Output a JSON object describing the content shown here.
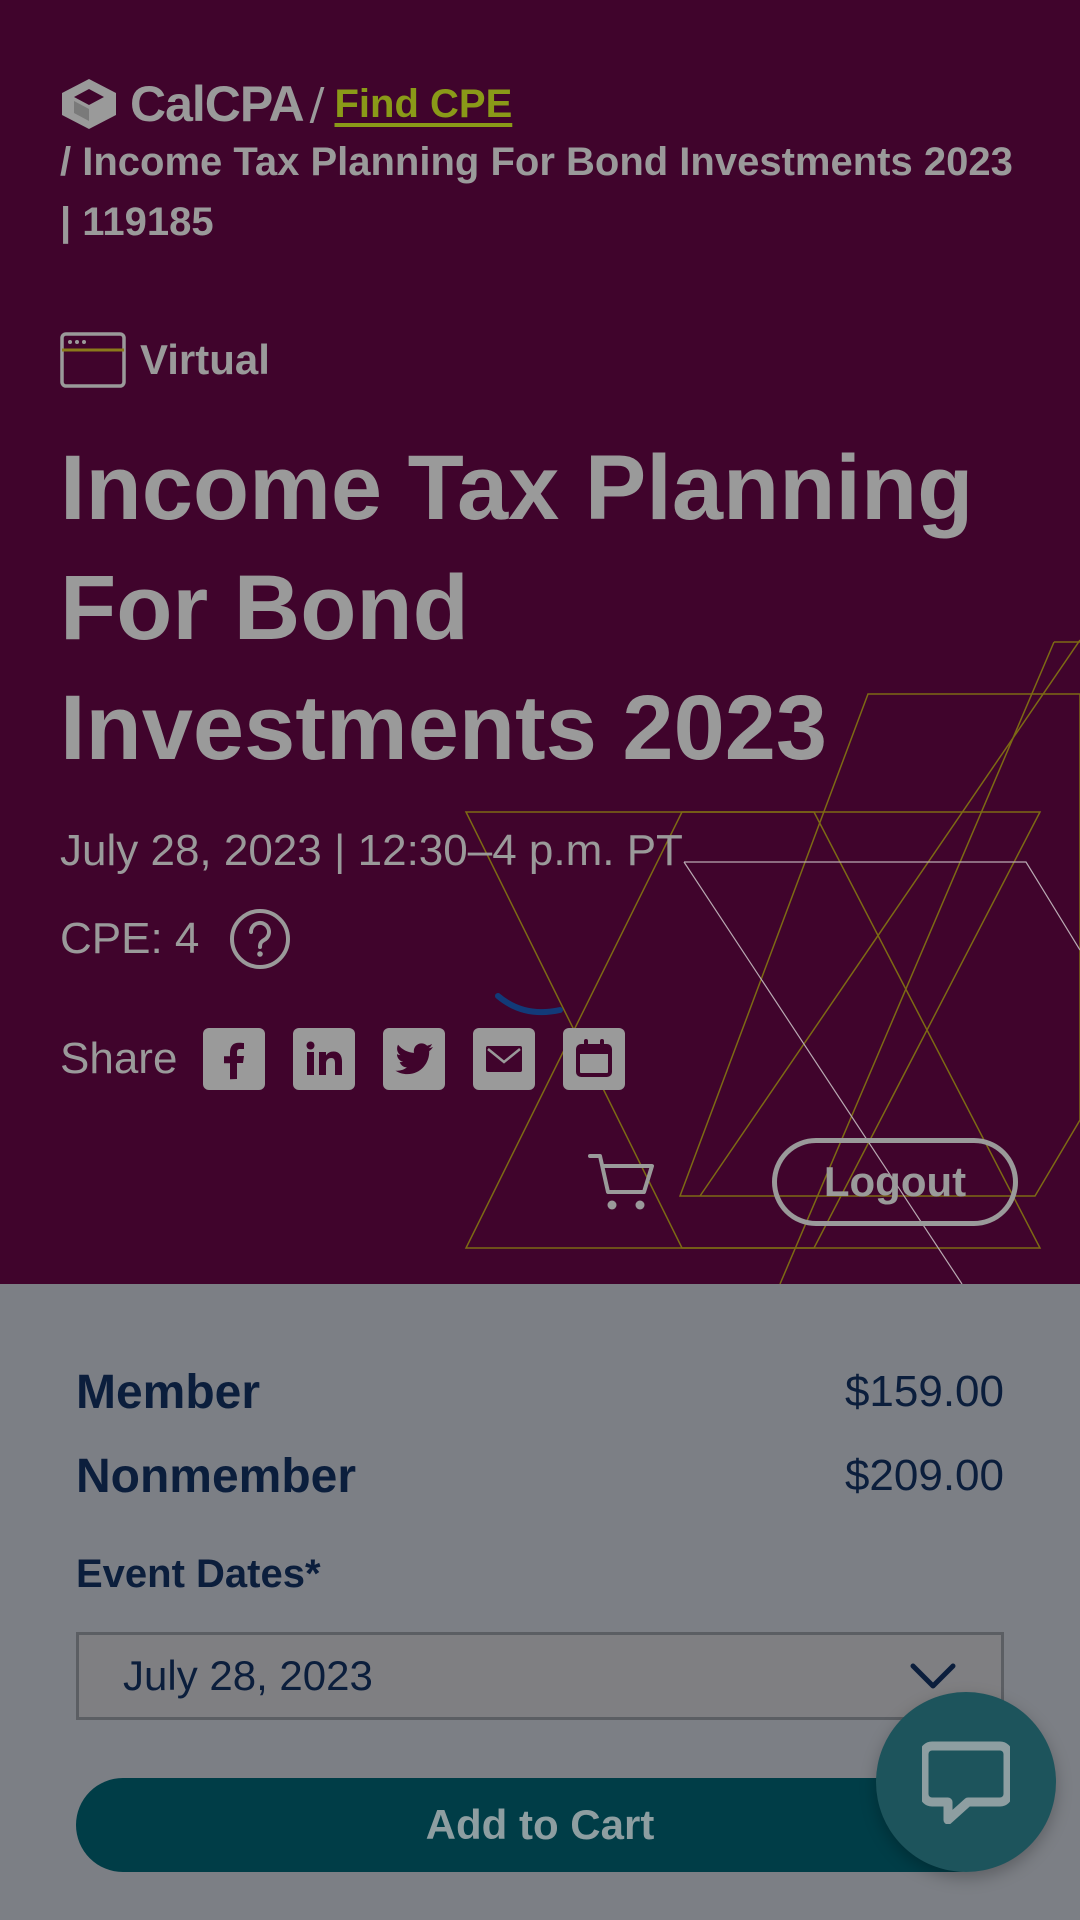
{
  "breadcrumb": {
    "logo_text": "CalCPA",
    "separator": "/",
    "link_label": "Find CPE",
    "current": "/ Income Tax Planning For Bond Investments 2023 | 119185"
  },
  "event": {
    "format": "Virtual",
    "title": "Income Tax Planning For Bond Investments 2023",
    "datetime": "July 28, 2023 | 12:30–4 p.m. PT",
    "cpe": "CPE: 4"
  },
  "share": {
    "label": "Share",
    "icons": [
      "facebook-icon",
      "linkedin-icon",
      "twitter-icon",
      "email-icon",
      "calendar-icon"
    ]
  },
  "header_actions": {
    "logout_label": "Logout"
  },
  "pricing": [
    {
      "label": "Member",
      "price": "$159.00"
    },
    {
      "label": "Nonmember",
      "price": "$209.00"
    }
  ],
  "event_dates": {
    "label": "Event Dates*",
    "selected": "July 28, 2023"
  },
  "add_to_cart_label": "Add to Cart",
  "colors": {
    "hero_bg": "#40042c",
    "link": "#8a9a18",
    "text_dark": "#0b1e3c",
    "cta_bg": "#003d47",
    "chat_bg": "#1d545c"
  }
}
